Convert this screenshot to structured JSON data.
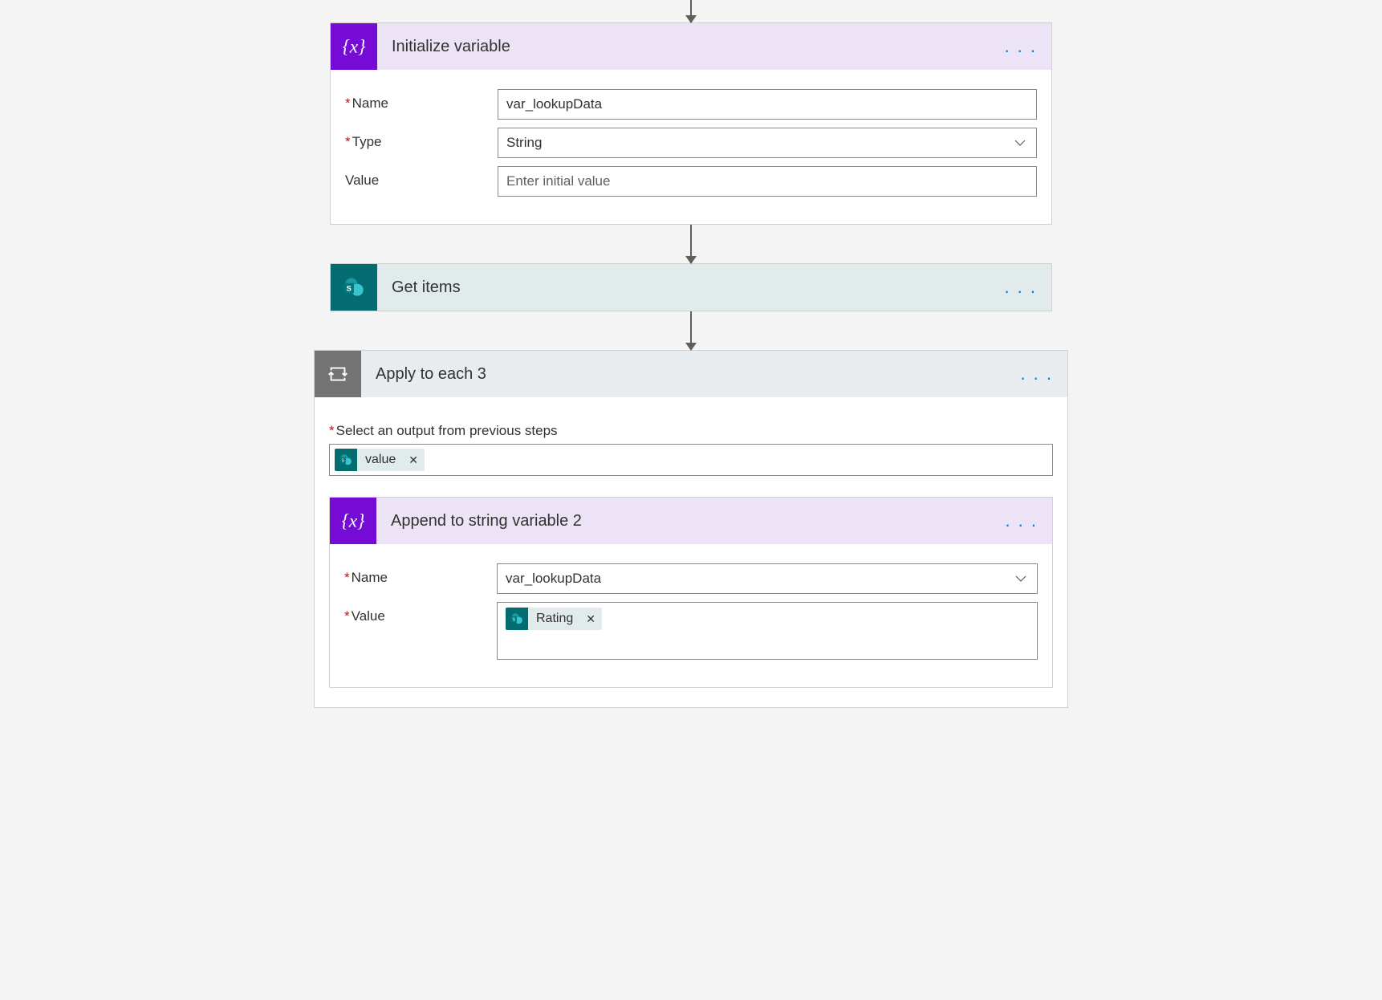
{
  "arrow_in": true,
  "step1": {
    "title": "Initialize variable",
    "fields": {
      "name_label": "Name",
      "name_value": "var_lookupData",
      "type_label": "Type",
      "type_value": "String",
      "value_label": "Value",
      "value_placeholder": "Enter initial value"
    }
  },
  "step2": {
    "title": "Get items"
  },
  "step3": {
    "title": "Apply to each 3",
    "select_label": "Select an output from previous steps",
    "select_token": "value",
    "inner": {
      "title": "Append to string variable 2",
      "name_label": "Name",
      "name_value": "var_lookupData",
      "value_label": "Value",
      "value_token": "Rating"
    }
  },
  "menu_dots": ". . ."
}
